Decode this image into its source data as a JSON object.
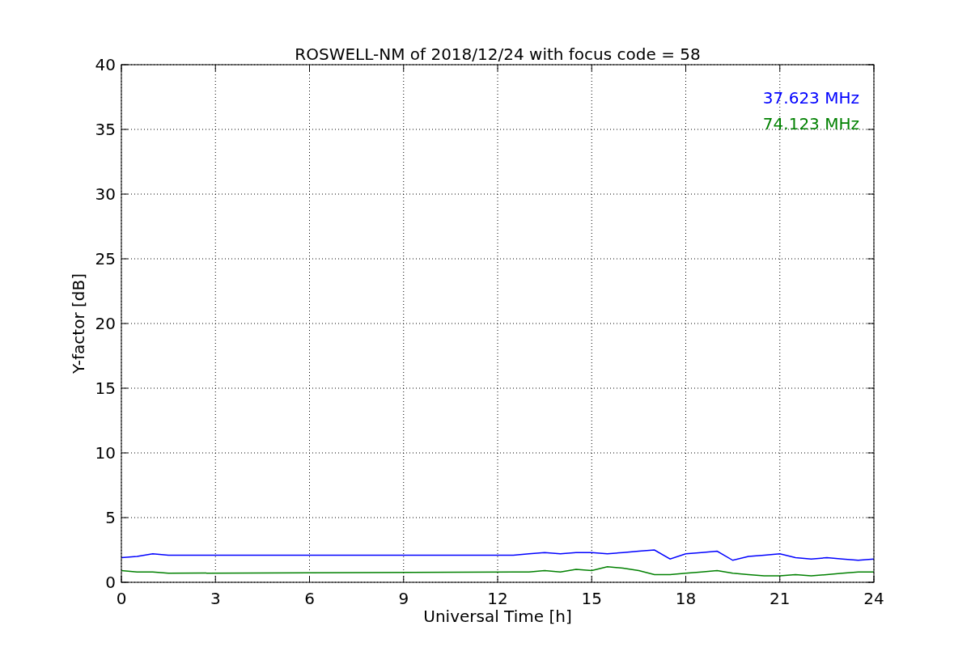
{
  "chart_data": {
    "type": "line",
    "title": "ROSWELL-NM of 2018/12/24 with focus code = 58",
    "xlabel": "Universal Time [h]",
    "ylabel": "Y-factor [dB]",
    "x": [
      0,
      0.5,
      1,
      1.5,
      12.5,
      13,
      13.5,
      14,
      14.5,
      15,
      15.5,
      16,
      16.5,
      17,
      17.5,
      18,
      18.5,
      19,
      19.5,
      20,
      20.5,
      21,
      21.5,
      22,
      22.5,
      23,
      23.5,
      24
    ],
    "series": [
      {
        "name": "37.623 MHz",
        "color": "#0000ff",
        "values": [
          1.9,
          2.0,
          2.2,
          2.1,
          2.1,
          2.2,
          2.3,
          2.2,
          2.3,
          2.3,
          2.2,
          2.3,
          2.4,
          2.5,
          1.8,
          2.2,
          2.3,
          2.4,
          1.7,
          2.0,
          2.1,
          2.2,
          1.9,
          1.8,
          1.9,
          1.8,
          1.7,
          1.8
        ]
      },
      {
        "name": "74.123 MHz",
        "color": "#008000",
        "values": [
          0.9,
          0.8,
          0.8,
          0.7,
          0.8,
          0.8,
          0.9,
          0.8,
          1.0,
          0.9,
          1.2,
          1.1,
          0.9,
          0.6,
          0.6,
          0.7,
          0.8,
          0.9,
          0.7,
          0.6,
          0.5,
          0.5,
          0.6,
          0.5,
          0.6,
          0.7,
          0.8,
          0.8
        ]
      }
    ],
    "grid": true,
    "xlim": [
      0,
      24
    ],
    "ylim": [
      0,
      40
    ],
    "xticks": [
      0,
      3,
      6,
      9,
      12,
      15,
      18,
      21,
      24
    ],
    "yticks": [
      0,
      5,
      10,
      15,
      20,
      25,
      30,
      35,
      40
    ]
  }
}
